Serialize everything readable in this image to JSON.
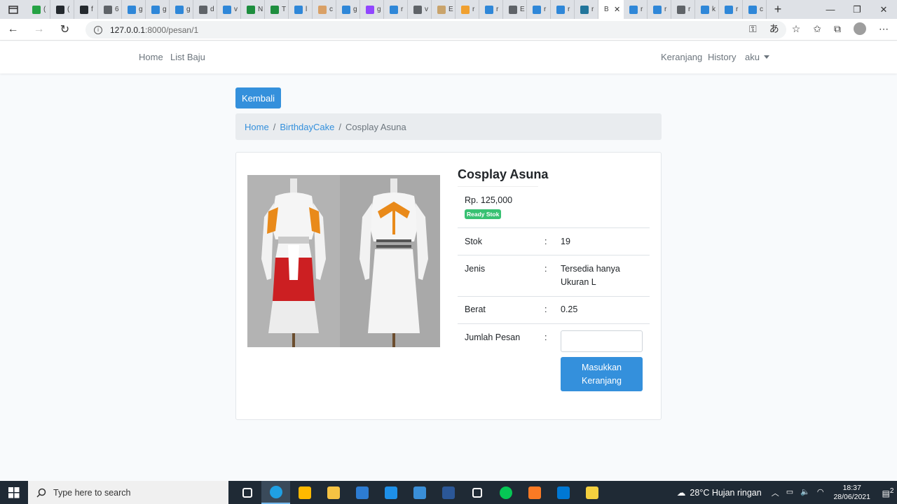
{
  "browser": {
    "tabs": [
      {
        "title": "(",
        "color": "#25a244"
      },
      {
        "title": "(",
        "color": "#24292e"
      },
      {
        "title": "f",
        "color": "#24292e"
      },
      {
        "title": "6",
        "color": "#5f6368"
      },
      {
        "title": "g",
        "color": "#2f87d8"
      },
      {
        "title": "g",
        "color": "#2f87d8"
      },
      {
        "title": "g",
        "color": "#2f87d8"
      },
      {
        "title": "d",
        "color": "#5f6368"
      },
      {
        "title": "v",
        "color": "#2f87d8"
      },
      {
        "title": "N",
        "color": "#1e8e3e"
      },
      {
        "title": "T",
        "color": "#1e8e3e"
      },
      {
        "title": "l",
        "color": "#2f87d8"
      },
      {
        "title": "c",
        "color": "#d9a066"
      },
      {
        "title": "g",
        "color": "#2f87d8"
      },
      {
        "title": "g",
        "color": "#9146ff"
      },
      {
        "title": "r",
        "color": "#2f87d8"
      },
      {
        "title": "v",
        "color": "#5f6368"
      },
      {
        "title": "E",
        "color": "#c9a36b"
      },
      {
        "title": "r",
        "color": "#f0a030"
      },
      {
        "title": "r",
        "color": "#2f87d8"
      },
      {
        "title": "E",
        "color": "#5f6368"
      },
      {
        "title": "r",
        "color": "#2f87d8"
      },
      {
        "title": "r",
        "color": "#2f87d8"
      },
      {
        "title": "r",
        "color": "#21759b"
      }
    ],
    "active_tab": {
      "title": "B",
      "close": "✕"
    },
    "tabs_after": [
      {
        "title": "r",
        "color": "#2f87d8"
      },
      {
        "title": "r",
        "color": "#2f87d8"
      },
      {
        "title": "r",
        "color": "#5f6368"
      },
      {
        "title": "k",
        "color": "#2f87d8"
      },
      {
        "title": "r",
        "color": "#2f87d8"
      },
      {
        "title": "c",
        "color": "#2f87d8"
      }
    ],
    "new_tab": "+",
    "url_host": "127.0.0.1",
    "url_path": ":8000/pesan/1"
  },
  "nav": {
    "home": "Home",
    "list_baju": "List Baju",
    "keranjang": "Keranjang",
    "history": "History",
    "user": "aku"
  },
  "page": {
    "back_button": "Kembali",
    "breadcrumb": {
      "home": "Home",
      "category": "BirthdayCake",
      "current": "Cosplay Asuna",
      "separator": "/"
    },
    "product": {
      "title": "Cosplay Asuna",
      "price": "Rp. 125,000",
      "badge": "Ready Stok",
      "badge_color": "#38c172",
      "stok_label": "Stok",
      "stok_value": "19",
      "jenis_label": "Jenis",
      "jenis_value_line1": "Tersedia hanya",
      "jenis_value_line2": "Ukuran L",
      "berat_label": "Berat",
      "berat_value": "0.25",
      "jumlah_label": "Jumlah Pesan",
      "colon": ":",
      "quantity_value": "",
      "cart_button_line1": "Masukkan",
      "cart_button_line2": "Keranjang"
    },
    "accent_color": "#3490dc"
  },
  "taskbar": {
    "search_placeholder": "Type here to search",
    "weather": "28°C  Hujan ringan",
    "time": "18:37",
    "date": "28/06/2021",
    "notifications": "2",
    "apps": [
      {
        "icon": "task-view-icon",
        "color": "#ffffff"
      },
      {
        "icon": "edge-icon",
        "color": "#1fa0e3"
      },
      {
        "icon": "store-icon",
        "color": "#ffb900"
      },
      {
        "icon": "file-explorer-icon",
        "color": "#f6c343"
      },
      {
        "icon": "mail-icon",
        "color": "#2d7cd2"
      },
      {
        "icon": "app-blue-icon",
        "color": "#1e90e8"
      },
      {
        "icon": "photos-icon",
        "color": "#3a8fd8"
      },
      {
        "icon": "word-icon",
        "color": "#2b5797"
      },
      {
        "icon": "settings-icon",
        "color": "#ffffff"
      },
      {
        "icon": "line-icon",
        "color": "#06c755"
      },
      {
        "icon": "xampp-icon",
        "color": "#fb7a24"
      },
      {
        "icon": "vscode-icon",
        "color": "#0078d4"
      },
      {
        "icon": "git-icon",
        "color": "#f4d03f"
      }
    ]
  }
}
